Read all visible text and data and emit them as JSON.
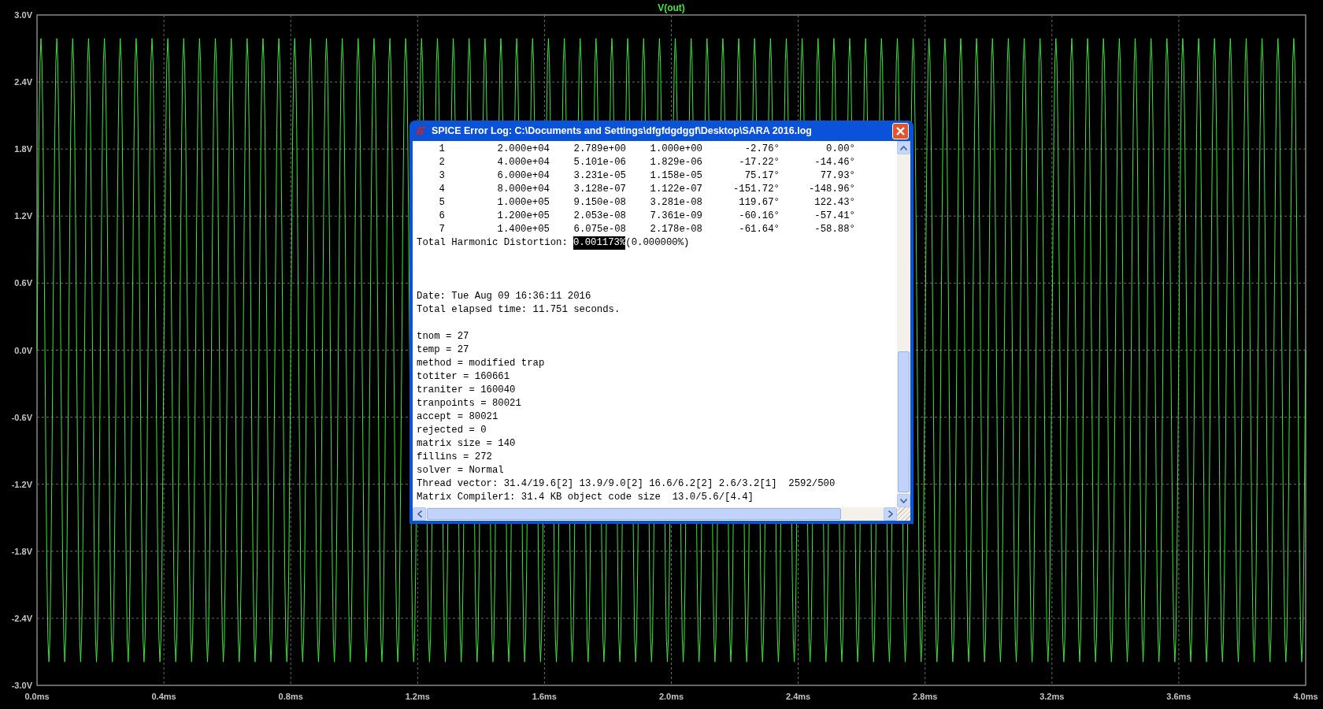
{
  "plot": {
    "trace_label": "V(out)",
    "y_ticks": [
      "3.0V",
      "2.4V",
      "1.8V",
      "1.2V",
      "0.6V",
      "0.0V",
      "-0.6V",
      "-1.2V",
      "-1.8V",
      "-2.4V",
      "-3.0V"
    ],
    "x_ticks": [
      "0.0ms",
      "0.4ms",
      "0.8ms",
      "1.2ms",
      "1.6ms",
      "2.0ms",
      "2.4ms",
      "2.8ms",
      "3.2ms",
      "3.6ms",
      "4.0ms"
    ]
  },
  "log_window": {
    "title": "SPICE Error Log: C:\\Documents and Settings\\dfgfdgdggf\\Desktop\\SARA 2016.log",
    "harmonics": [
      [
        "1",
        "2.000e+04",
        "2.789e+00",
        "1.000e+00",
        "-2.76°",
        "0.00°"
      ],
      [
        "2",
        "4.000e+04",
        "5.101e-06",
        "1.829e-06",
        "-17.22°",
        "-14.46°"
      ],
      [
        "3",
        "6.000e+04",
        "3.231e-05",
        "1.158e-05",
        "75.17°",
        "77.93°"
      ],
      [
        "4",
        "8.000e+04",
        "3.128e-07",
        "1.122e-07",
        "-151.72°",
        "-148.96°"
      ],
      [
        "5",
        "1.000e+05",
        "9.150e-08",
        "3.281e-08",
        "119.67°",
        "122.43°"
      ],
      [
        "6",
        "1.200e+05",
        "2.053e-08",
        "7.361e-09",
        "-60.16°",
        "-57.41°"
      ],
      [
        "7",
        "1.400e+05",
        "6.075e-08",
        "2.178e-08",
        "-61.64°",
        "-58.88°"
      ]
    ],
    "thd": {
      "label": "Total Harmonic Distortion:",
      "value": "0.001173%",
      "selected": true,
      "extra": "(0.000000%)"
    },
    "blocks": [
      [
        "Date: Tue Aug 09 16:36:11 2016",
        "Total elapsed time: 11.751 seconds."
      ],
      [
        "tnom = 27",
        "temp = 27",
        "method = modified trap",
        "totiter = 160661",
        "traniter = 160040",
        "tranpoints = 80021",
        "accept = 80021",
        "rejected = 0",
        "matrix size = 140",
        "fillins = 272",
        "solver = Normal",
        "Thread vector: 31.4/19.6[2] 13.9/9.0[2] 16.6/6.2[2] 2.6/3.2[1]  2592/500",
        "Matrix Compiler1: 31.4 KB object code size  13.0/5.6/[4.4]"
      ]
    ]
  }
}
